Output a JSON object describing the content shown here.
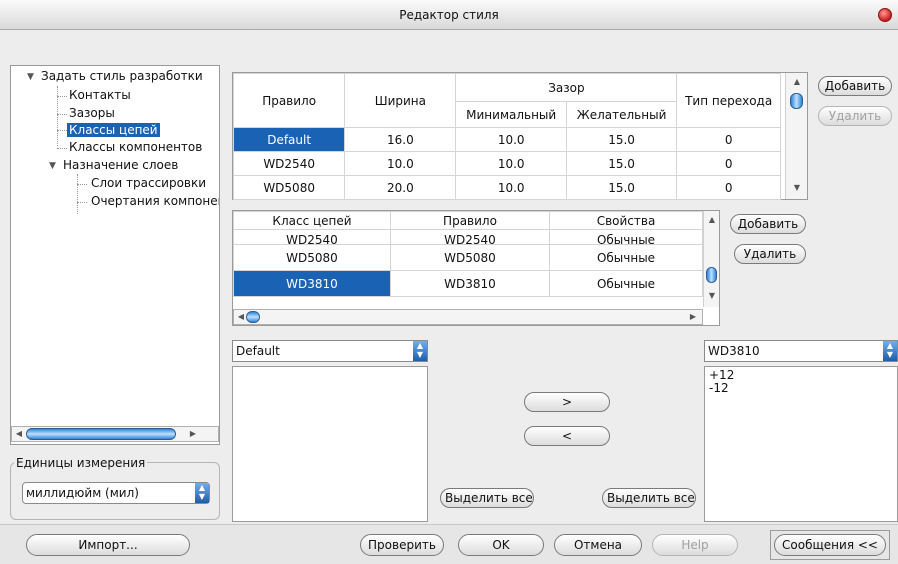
{
  "window": {
    "title": "Редактор стиля"
  },
  "tree": {
    "items": [
      {
        "label": "Задать стиль разработки"
      },
      {
        "label": "Контакты"
      },
      {
        "label": "Зазоры"
      },
      {
        "label": "Классы цепей"
      },
      {
        "label": "Классы компонентов"
      },
      {
        "label": "Назначение слоев"
      },
      {
        "label": "Слои трассировки"
      },
      {
        "label": "Очертания компонен"
      }
    ]
  },
  "units": {
    "legend": "Единицы измерения",
    "selected": "миллидюйм (мил)"
  },
  "rules_table": {
    "headers": {
      "rule": "Правило",
      "width": "Ширина",
      "gap": "Зазор",
      "gap_min": "Минимальный",
      "gap_pref": "Желательный",
      "via_type": "Тип перехода"
    },
    "rows": [
      {
        "rule": "Default",
        "width": "16.0",
        "min": "10.0",
        "pref": "15.0",
        "via": "0"
      },
      {
        "rule": "WD2540",
        "width": "10.0",
        "min": "10.0",
        "pref": "15.0",
        "via": "0"
      },
      {
        "rule": "WD5080",
        "width": "20.0",
        "min": "10.0",
        "pref": "15.0",
        "via": "0"
      }
    ],
    "add_label": "Добавить",
    "delete_label": "Удалить"
  },
  "class_table": {
    "headers": {
      "net_class": "Класс цепей",
      "rule": "Правило",
      "props": "Свойства"
    },
    "partial_row": {
      "net_class": "WD2540",
      "rule": "WD2540",
      "props": "Обычные"
    },
    "rows": [
      {
        "net_class": "WD5080",
        "rule": "WD5080",
        "props": "Обычные"
      },
      {
        "net_class": "WD3810",
        "rule": "WD3810",
        "props": "Обычные"
      }
    ],
    "add_label": "Добавить",
    "delete_label": "Удалить"
  },
  "left_select": {
    "value": "Default"
  },
  "right_select": {
    "value": "WD3810"
  },
  "right_list": [
    "+12",
    "-12"
  ],
  "move_right_label": ">",
  "move_left_label": "<",
  "select_all_left": "Выделить все",
  "select_all_right": "Выделить все",
  "footer": {
    "import": "Импорт...",
    "check": "Проверить",
    "ok": "OK",
    "cancel": "Отмена",
    "help": "Help",
    "messages": "Сообщения <<"
  },
  "colors": {
    "selection": "#1a63b4",
    "accent_scroll": "#2d84d8",
    "close": "#c81d1d"
  },
  "icons": {
    "close": "close-icon",
    "tree_expand": "triangle-down-icon"
  }
}
